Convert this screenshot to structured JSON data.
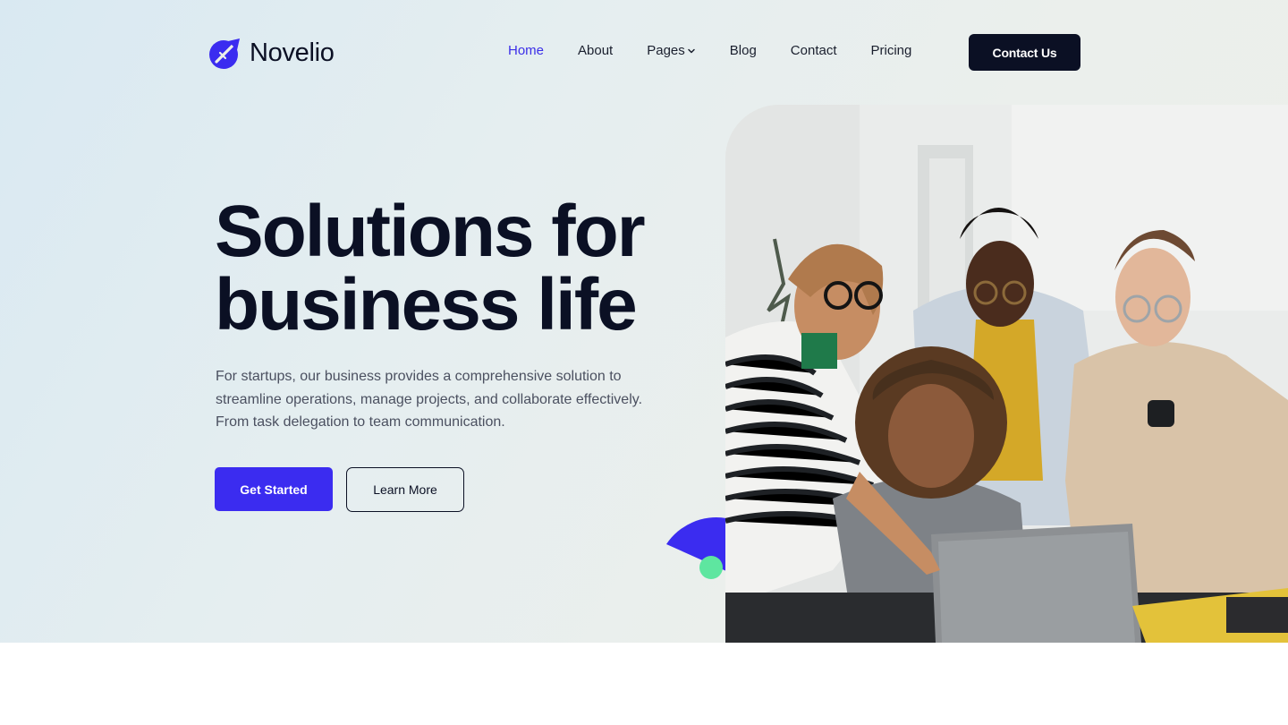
{
  "brand": {
    "name": "Novelio",
    "accent": "#3b2cf0",
    "dark": "#0b1024",
    "highlight": "#5ee6a0"
  },
  "nav": {
    "items": [
      {
        "label": "Home",
        "active": true
      },
      {
        "label": "About"
      },
      {
        "label": "Pages",
        "dropdown": true
      },
      {
        "label": "Blog"
      },
      {
        "label": "Contact"
      },
      {
        "label": "Pricing"
      }
    ],
    "cta": "Contact Us"
  },
  "hero": {
    "headline_line1": "Solutions for",
    "headline_line2": "business life",
    "description": "For startups, our business provides a comprehensive solution to streamline operations, manage projects, and collaborate effectively. From task delegation to team communication.",
    "primary_button": "Get Started",
    "secondary_button": "Learn More"
  },
  "icons": {
    "logo": "rocket-arrow-icon",
    "dropdown": "chevron-down-icon"
  }
}
